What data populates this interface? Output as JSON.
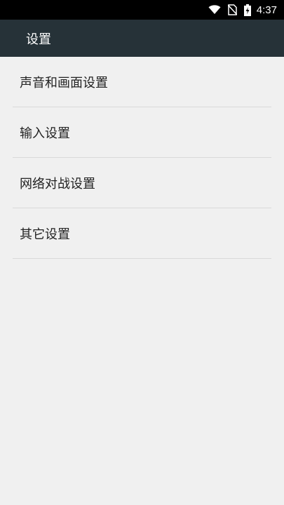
{
  "status_bar": {
    "time": "4:37",
    "icons": [
      "wifi-icon",
      "no-sim-icon",
      "battery-charging-icon"
    ]
  },
  "app_bar": {
    "title": "设置"
  },
  "menu": {
    "items": [
      {
        "label": "声音和画面设置"
      },
      {
        "label": "输入设置"
      },
      {
        "label": "网络对战设置"
      },
      {
        "label": "其它设置"
      }
    ]
  },
  "colors": {
    "status_bar_bg": "#000000",
    "app_bar_bg": "#263238",
    "page_bg": "#f0f0f0",
    "divider": "#d9d9d9",
    "text_primary": "#222222"
  }
}
